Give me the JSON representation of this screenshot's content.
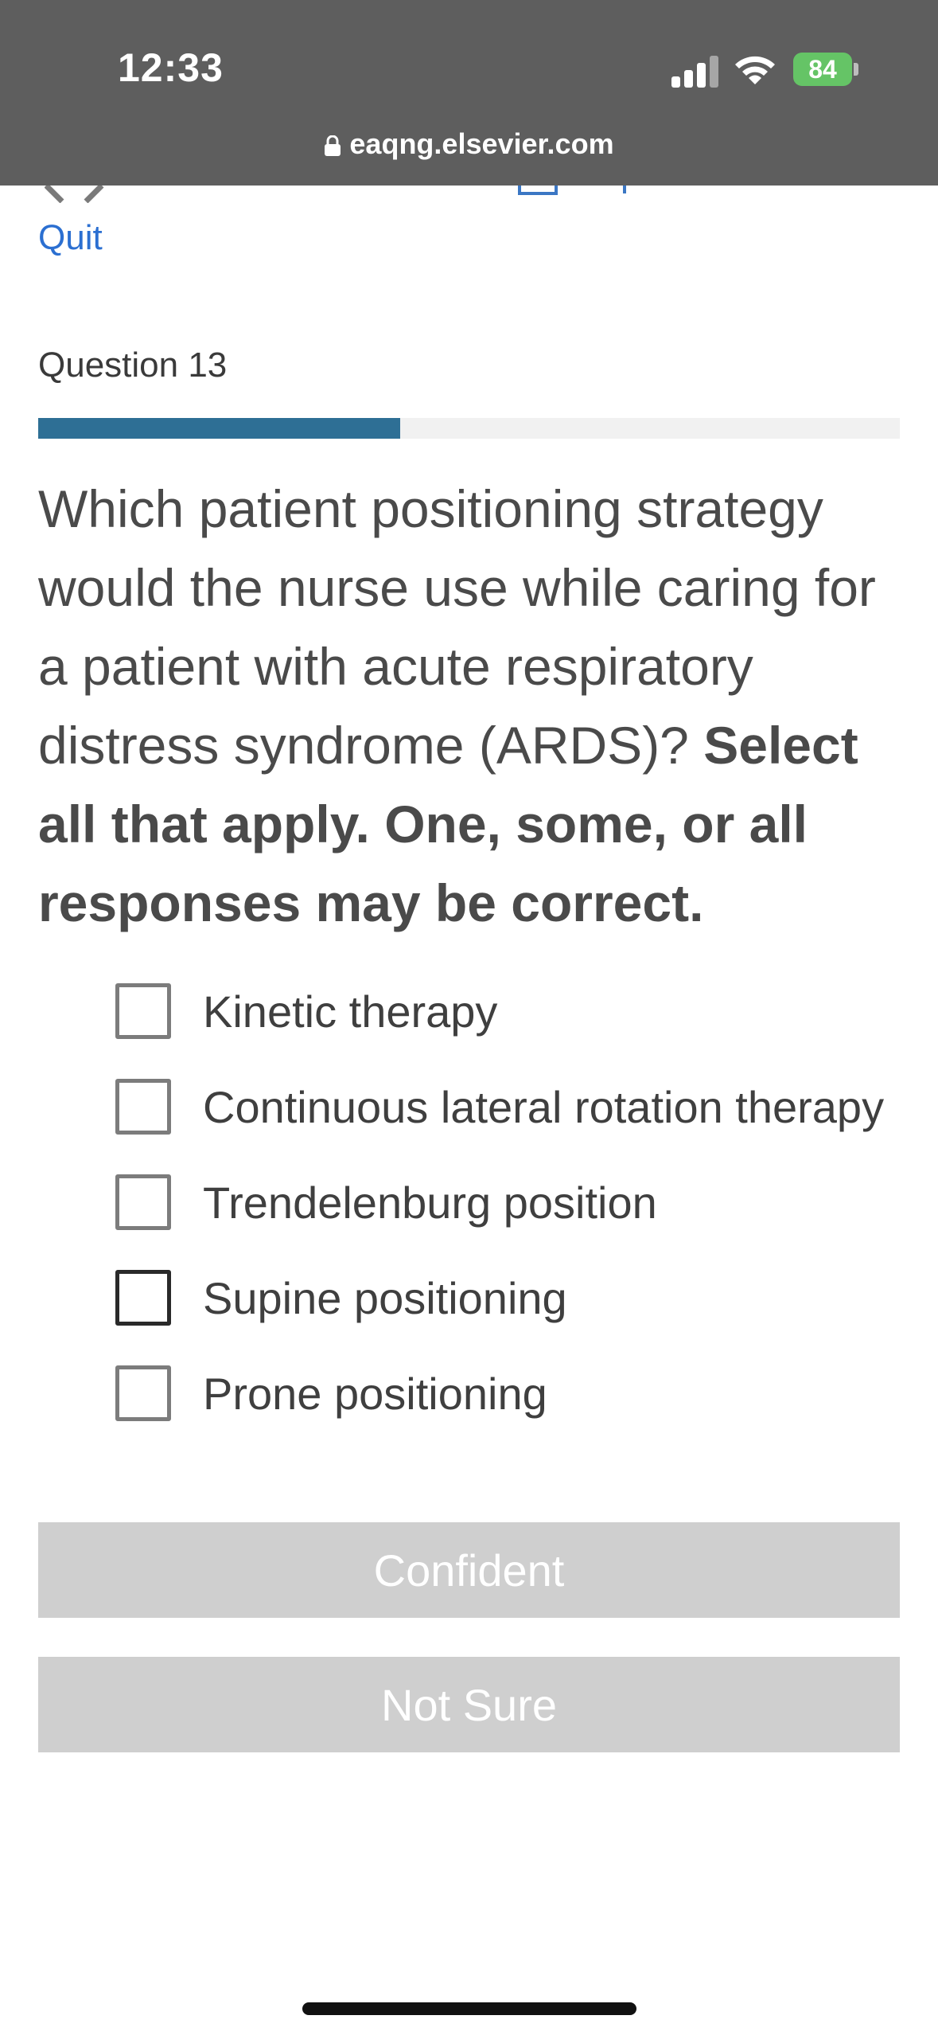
{
  "status_bar": {
    "time": "12:33",
    "battery": "84",
    "url": "eaqng.elsevier.com"
  },
  "header": {
    "quit_label": "Quit"
  },
  "question": {
    "label": "Question 13",
    "progress_fraction": 0.42,
    "text_plain": "Which patient positioning strategy would the nurse use while caring for a patient with acute respiratory distress syndrome (ARDS)? ",
    "text_bold": "Select all that apply. One, some, or all responses may be correct."
  },
  "options": [
    "Kinetic therapy",
    "Continuous lateral rotation therapy",
    "Trendelenburg position",
    "Supine positioning",
    "Prone positioning"
  ],
  "buttons": {
    "confident": "Confident",
    "not_sure": "Not Sure"
  },
  "colors": {
    "status_bar_bg": "#5e5e5e",
    "link_blue": "#2b6fd1",
    "progress_fill": "#2e6f95",
    "button_disabled": "#cfcfcf",
    "battery_green": "#65c466"
  }
}
